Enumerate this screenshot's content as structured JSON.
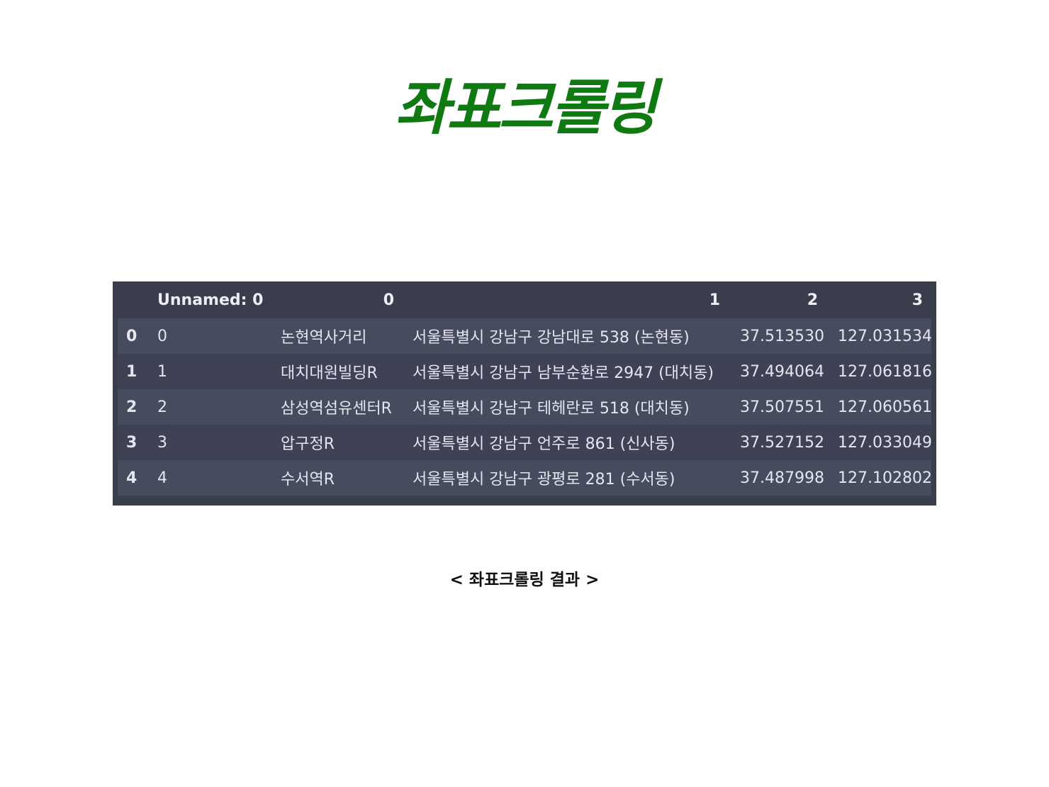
{
  "title": "좌표크롤링",
  "table": {
    "columns": [
      "",
      "Unnamed: 0",
      "0",
      "1",
      "2",
      "3"
    ],
    "rows": [
      {
        "index": "0",
        "unnamed": "0",
        "c0": "논현역사거리",
        "c1": "서울특별시 강남구 강남대로 538 (논현동)",
        "c2": "37.513530",
        "c3": "127.031534"
      },
      {
        "index": "1",
        "unnamed": "1",
        "c0": "대치대원빌딩R",
        "c1": "서울특별시 강남구 남부순환로 2947 (대치동)",
        "c2": "37.494064",
        "c3": "127.061816"
      },
      {
        "index": "2",
        "unnamed": "2",
        "c0": "삼성역섬유센터R",
        "c1": "서울특별시 강남구 테헤란로 518 (대치동)",
        "c2": "37.507551",
        "c3": "127.060561"
      },
      {
        "index": "3",
        "unnamed": "3",
        "c0": "압구정R",
        "c1": "서울특별시 강남구 언주로 861 (신사동)",
        "c2": "37.527152",
        "c3": "127.033049"
      },
      {
        "index": "4",
        "unnamed": "4",
        "c0": "수서역R",
        "c1": "서울특별시 강남구 광평로 281 (수서동)",
        "c2": "37.487998",
        "c3": "127.102802"
      }
    ]
  },
  "caption": "< 좌표크롤링 결과 >",
  "colors": {
    "title": "#0f7a12",
    "table_background": "#3a3d4c",
    "row_odd": "#474b5e",
    "row_even": "#3e4254",
    "table_text": "#e4e6ee"
  }
}
